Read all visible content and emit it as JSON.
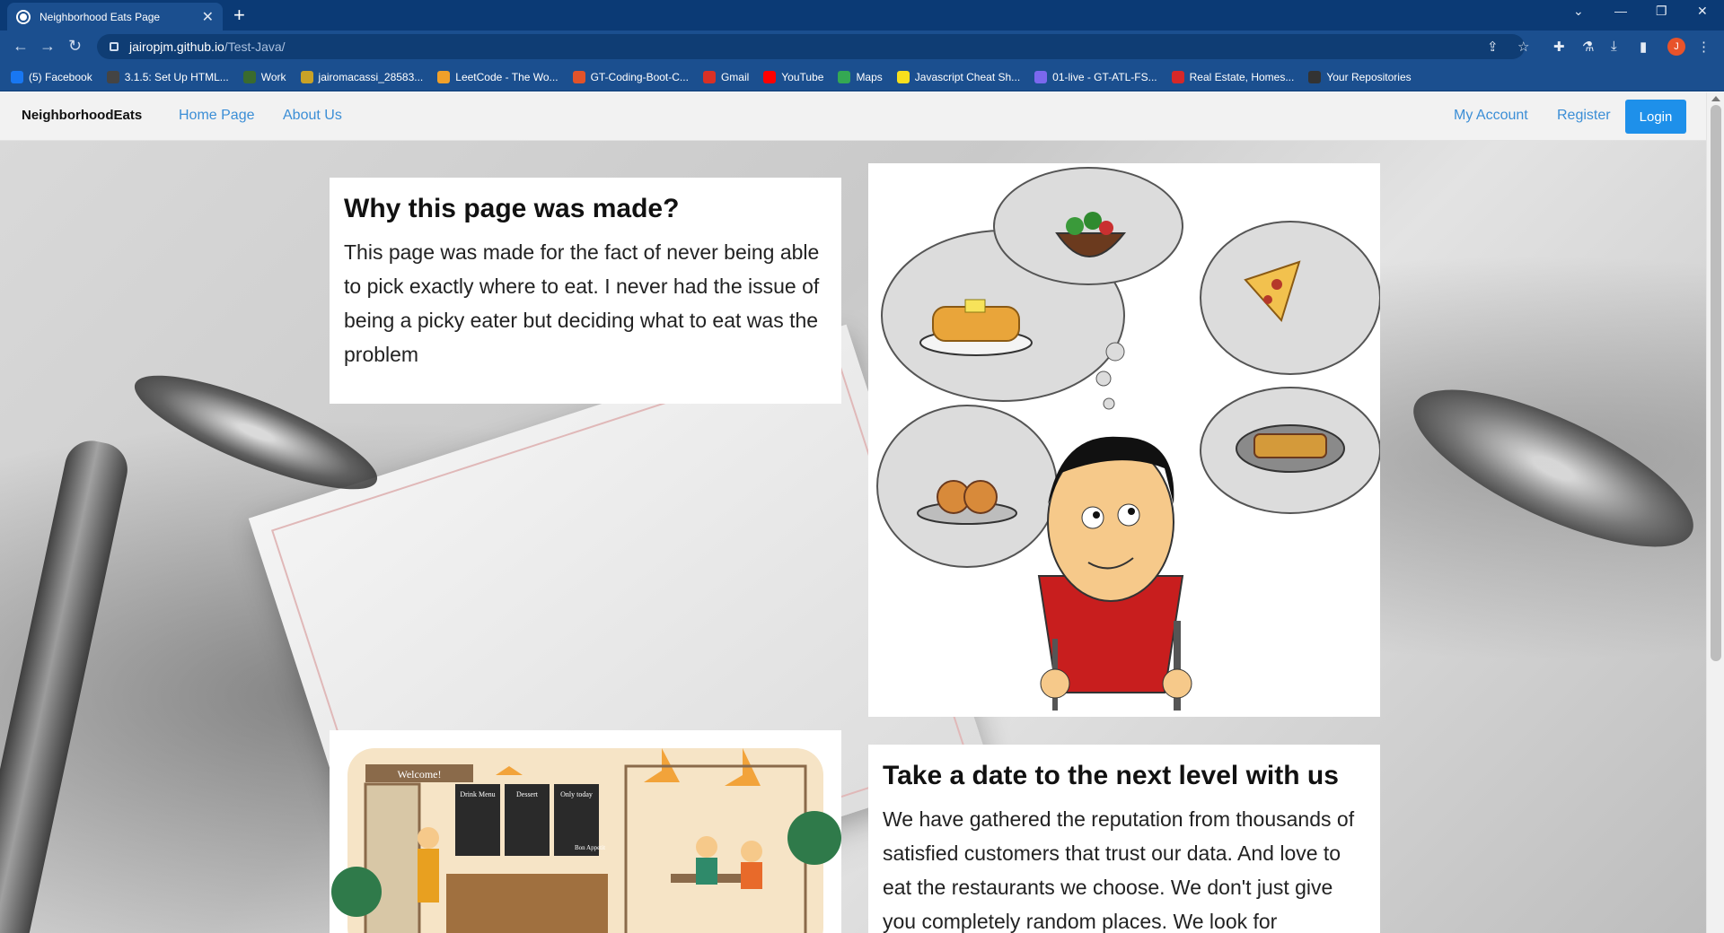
{
  "browser": {
    "tab_title": "Neighborhood Eats Page",
    "url_host": "jairopjm.github.io",
    "url_path": "/Test-Java/",
    "profile_initial": "J",
    "bookmarks": [
      {
        "label": "(5) Facebook",
        "color": "#1877f2"
      },
      {
        "label": "3.1.5: Set Up HTML...",
        "color": "#444444"
      },
      {
        "label": "Work",
        "color": "#3a6b2e"
      },
      {
        "label": "jairomacassi_28583...",
        "color": "#c9a227"
      },
      {
        "label": "LeetCode - The Wo...",
        "color": "#f0a02a"
      },
      {
        "label": "GT-Coding-Boot-C...",
        "color": "#e2532a"
      },
      {
        "label": "Gmail",
        "color": "#d93025"
      },
      {
        "label": "YouTube",
        "color": "#ff0000"
      },
      {
        "label": "Maps",
        "color": "#34a853"
      },
      {
        "label": "Javascript Cheat Sh...",
        "color": "#f7df1e"
      },
      {
        "label": "01-live - GT-ATL-FS...",
        "color": "#7b68ee"
      },
      {
        "label": "Real Estate, Homes...",
        "color": "#d62828"
      },
      {
        "label": "Your Repositories",
        "color": "#333333"
      }
    ]
  },
  "nav": {
    "brand": "NeighborhoodEats",
    "home": "Home Page",
    "about": "About Us",
    "account": "My Account",
    "register": "Register",
    "login": "Login"
  },
  "section1": {
    "title": "Why this page was made?",
    "body": "This page was made for the fact of never being able to pick exactly where to eat. I never had the issue of being a picky eater but deciding what to eat was the problem"
  },
  "section2": {
    "title": "Take a date to the next level with us",
    "body": "We have gathered the reputation from thousands of satisfied customers that trust our data. And love to eat the restaurants we choose. We don't just give you completely random places. We look for"
  },
  "illustration1": {
    "icon": "thinking-man-food-illustration"
  },
  "illustration2": {
    "icon": "restaurant-scene-illustration",
    "signs": [
      "Welcome!",
      "Drink Menu",
      "Dessert",
      "Only today",
      "Bon Appetit"
    ]
  },
  "colors": {
    "accent": "#1e90ea",
    "link": "#3b8ed6",
    "chrome": "#1b4f8f"
  }
}
